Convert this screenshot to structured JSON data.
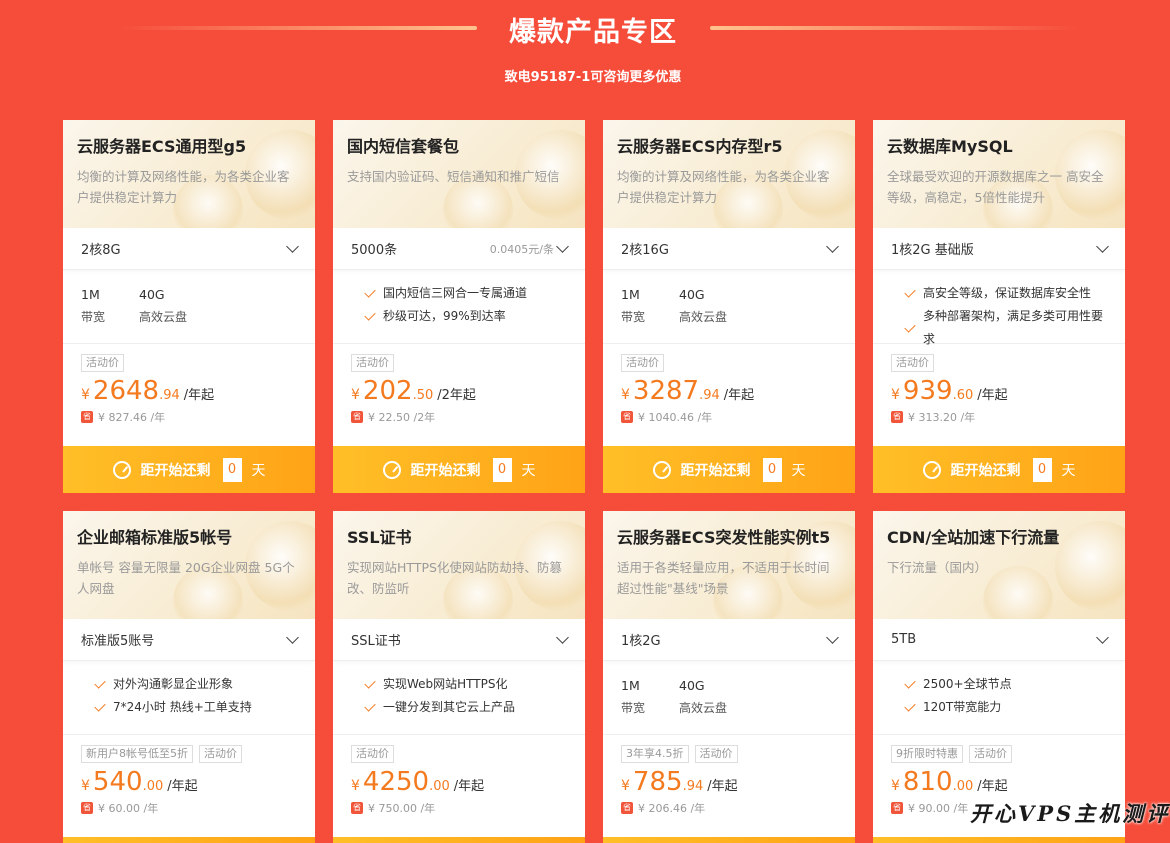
{
  "header": {
    "title": "爆款产品专区",
    "subtitle": "致电95187-1可咨询更多优惠"
  },
  "common": {
    "cta_prefix": "距开始还剩",
    "cta_days": "0",
    "cta_unit": "天"
  },
  "watermark": "开心VPS主机测评",
  "cards": [
    {
      "title": "云服务器ECS通用型g5",
      "desc": "均衡的计算及网络性能，为各类企业客户提供稳定计算力",
      "select": "2核8G",
      "select_unit": "",
      "specs": [
        {
          "value": "1M",
          "label": "带宽"
        },
        {
          "value": "40G",
          "label": "高效云盘"
        }
      ],
      "features": [],
      "tags": [
        "活动价"
      ],
      "price_currency": "¥",
      "price_int": "2648",
      "price_dec": ".94",
      "price_per": "/年起",
      "orig_badge": "省",
      "orig_price": "¥ 827.46 /年"
    },
    {
      "title": "国内短信套餐包",
      "desc": "支持国内验证码、短信通知和推广短信",
      "select": "5000条",
      "select_unit": "0.0405元/条",
      "specs": [],
      "features": [
        "国内短信三网合一专属通道",
        "秒级可达，99%到达率"
      ],
      "tags": [
        "活动价"
      ],
      "price_currency": "¥",
      "price_int": "202",
      "price_dec": ".50",
      "price_per": "/2年起",
      "orig_badge": "省",
      "orig_price": "¥ 22.50 /2年"
    },
    {
      "title": "云服务器ECS内存型r5",
      "desc": "均衡的计算及网络性能，为各类企业客户提供稳定计算力",
      "select": "2核16G",
      "select_unit": "",
      "specs": [
        {
          "value": "1M",
          "label": "带宽"
        },
        {
          "value": "40G",
          "label": "高效云盘"
        }
      ],
      "features": [],
      "tags": [
        "活动价"
      ],
      "price_currency": "¥",
      "price_int": "3287",
      "price_dec": ".94",
      "price_per": "/年起",
      "orig_badge": "省",
      "orig_price": "¥ 1040.46 /年"
    },
    {
      "title": "云数据库MySQL",
      "desc": "全球最受欢迎的开源数据库之一 高安全等级，高稳定，5倍性能提升",
      "select": "1核2G 基础版",
      "select_unit": "",
      "specs": [],
      "features": [
        "高安全等级，保证数据库安全性",
        "多种部署架构，满足多类可用性要求"
      ],
      "tags": [
        "活动价"
      ],
      "price_currency": "¥",
      "price_int": "939",
      "price_dec": ".60",
      "price_per": "/年起",
      "orig_badge": "省",
      "orig_price": "¥ 313.20 /年"
    },
    {
      "title": "企业邮箱标准版5帐号",
      "desc": "单帐号 容量无限量 20G企业网盘 5G个人网盘",
      "select": "标准版5账号",
      "select_unit": "",
      "specs": [],
      "features": [
        "对外沟通彰显企业形象",
        "7*24小时 热线+工单支持"
      ],
      "tags": [
        "新用户8帐号低至5折",
        "活动价"
      ],
      "price_currency": "¥",
      "price_int": "540",
      "price_dec": ".00",
      "price_per": "/年起",
      "orig_badge": "省",
      "orig_price": "¥ 60.00 /年"
    },
    {
      "title": "SSL证书",
      "desc": "实现网站HTTPS化使网站防劫持、防篡改、防监听",
      "select": "SSL证书",
      "select_unit": "",
      "specs": [],
      "features": [
        "实现Web网站HTTPS化",
        "一键分发到其它云上产品"
      ],
      "tags": [
        "活动价"
      ],
      "price_currency": "¥",
      "price_int": "4250",
      "price_dec": ".00",
      "price_per": "/年起",
      "orig_badge": "省",
      "orig_price": "¥ 750.00 /年"
    },
    {
      "title": "云服务器ECS突发性能实例t5",
      "desc": "适用于各类轻量应用，不适用于长时间超过性能\"基线\"场景",
      "select": "1核2G",
      "select_unit": "",
      "specs": [
        {
          "value": "1M",
          "label": "带宽"
        },
        {
          "value": "40G",
          "label": "高效云盘"
        }
      ],
      "features": [],
      "tags": [
        "3年享4.5折",
        "活动价"
      ],
      "price_currency": "¥",
      "price_int": "785",
      "price_dec": ".94",
      "price_per": "/年起",
      "orig_badge": "省",
      "orig_price": "¥ 206.46 /年"
    },
    {
      "title": "CDN/全站加速下行流量",
      "desc": "下行流量（国内）",
      "select": "5TB",
      "select_unit": "",
      "specs": [],
      "features": [
        "2500+全球节点",
        "120T带宽能力"
      ],
      "tags": [
        "9折限时特惠",
        "活动价"
      ],
      "price_currency": "¥",
      "price_int": "810",
      "price_dec": ".00",
      "price_per": "/年起",
      "orig_badge": "省",
      "orig_price": "¥ 90.00 /年"
    }
  ]
}
